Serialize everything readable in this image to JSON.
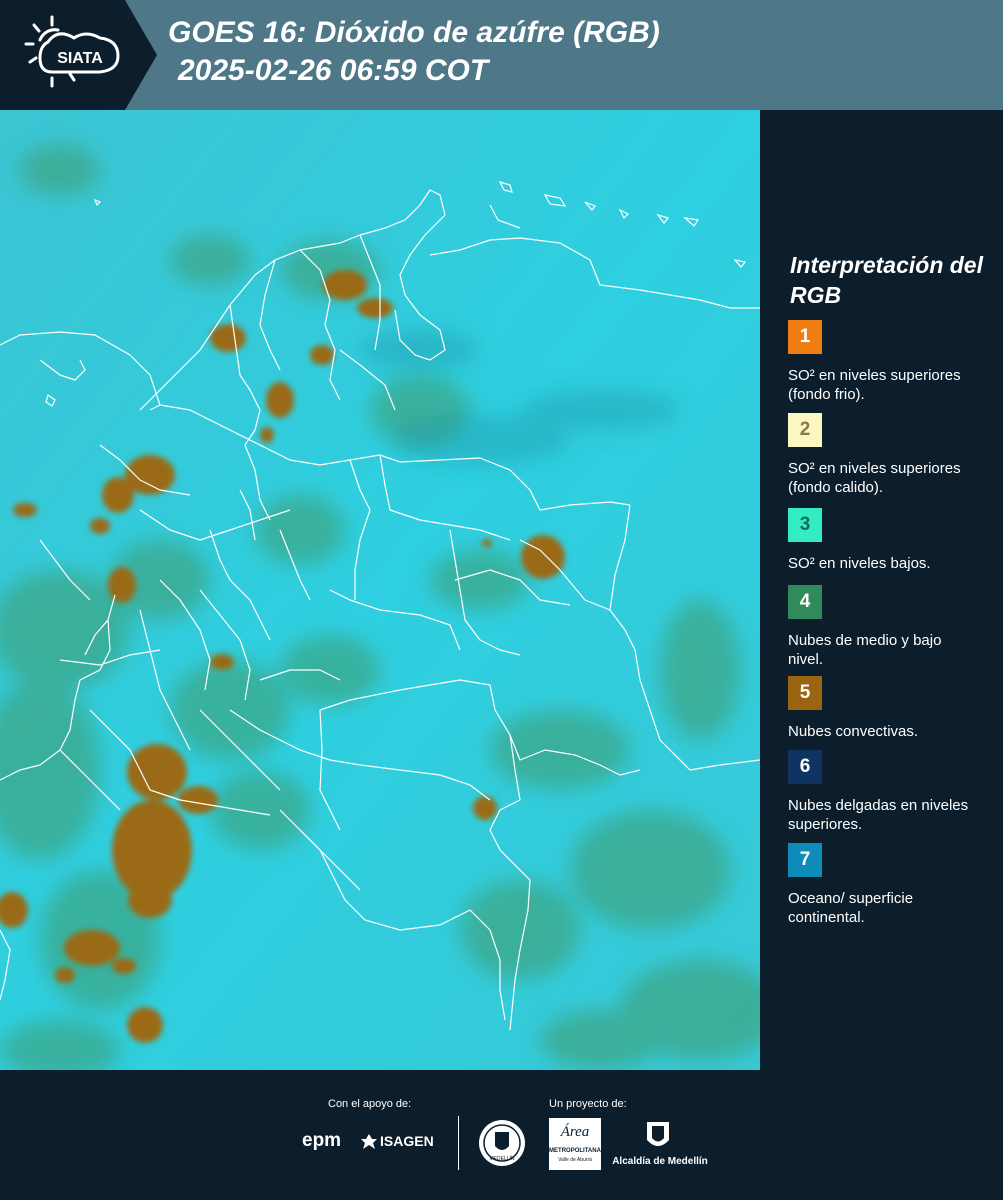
{
  "header": {
    "logo_text": "SIATA",
    "title_line1": "GOES 16: Dióxido de azúfre (RGB)",
    "title_line2": "2025-02-26 06:59 COT",
    "background": "#4e7888"
  },
  "legend": {
    "title": "Interpretación del RGB",
    "items": [
      {
        "number": "1",
        "color": "#f07d12",
        "text_color": "#ffffff",
        "description": "SO² en niveles superiores (fondo frio)."
      },
      {
        "number": "2",
        "color": "#fbf6c2",
        "text_color": "#8a7a40",
        "description": "SO² en niveles superiores (fondo calido)."
      },
      {
        "number": "3",
        "color": "#34ecc4",
        "text_color": "#0e6e5a",
        "description": "SO² en niveles bajos."
      },
      {
        "number": "4",
        "color": "#2f8a5c",
        "text_color": "#ffffff",
        "description": "Nubes de medio y bajo nivel."
      },
      {
        "number": "5",
        "color": "#9a6410",
        "text_color": "#ffffff",
        "description": "Nubes convectivas."
      },
      {
        "number": "6",
        "color": "#0f3462",
        "text_color": "#ffffff",
        "description": "Nubes delgadas en niveles superiores."
      },
      {
        "number": "7",
        "color": "#0e8bb8",
        "text_color": "#ffffff",
        "description": "Oceano/ superficie continental."
      }
    ]
  },
  "footer": {
    "support_label": "Con el apoyo de:",
    "project_label": "Un proyecto de:",
    "sponsor1": "epm",
    "sponsor2": "ISAGEN",
    "partner1": "MEDELLÍN",
    "partner2_line1": "Área",
    "partner2_line2": "METROPOLITANA",
    "partner2_line3": "Valle de Aburrá",
    "partner3": "Alcaldía de Medellín"
  },
  "colors": {
    "map_base": "#2ec8d8",
    "map_green": "#3f9a6a",
    "map_convective": "#9a6a18",
    "borders": "#ffffff"
  }
}
